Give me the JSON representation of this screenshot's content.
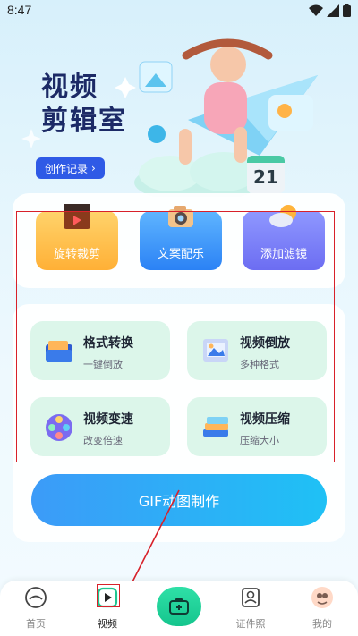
{
  "status": {
    "time": "8:47",
    "icons": [
      "wifi-icon",
      "signal-icon",
      "battery-icon"
    ]
  },
  "hero": {
    "title_line1": "视频",
    "title_line2": "剪辑室",
    "records_label": "创作记录",
    "calendar_number": "21"
  },
  "features": [
    {
      "label": "旋转裁剪",
      "icon": "film-clapper-icon"
    },
    {
      "label": "文案配乐",
      "icon": "camera-icon"
    },
    {
      "label": "添加滤镜",
      "icon": "cloud-sun-icon"
    }
  ],
  "tools": [
    {
      "name": "格式转换",
      "sub": "一键倒放",
      "icon": "folder-icon"
    },
    {
      "name": "视频倒放",
      "sub": "多种格式",
      "icon": "picture-frame-icon"
    },
    {
      "name": "视频变速",
      "sub": "改变倍速",
      "icon": "film-reel-icon"
    },
    {
      "name": "视频压缩",
      "sub": "压缩大小",
      "icon": "layers-icon"
    }
  ],
  "gif_button": "GIF动图制作",
  "nav": [
    {
      "label": "首页",
      "icon": "home-icon"
    },
    {
      "label": "视频",
      "icon": "play-icon"
    },
    {
      "label": "",
      "icon": "camera-add-icon"
    },
    {
      "label": "证件照",
      "icon": "id-photo-icon"
    },
    {
      "label": "我的",
      "icon": "avatar-icon"
    }
  ],
  "colors": {
    "accent_blue": "#2f5ae6",
    "mint": "#dcf6ea",
    "highlight_red": "#d8212a"
  }
}
